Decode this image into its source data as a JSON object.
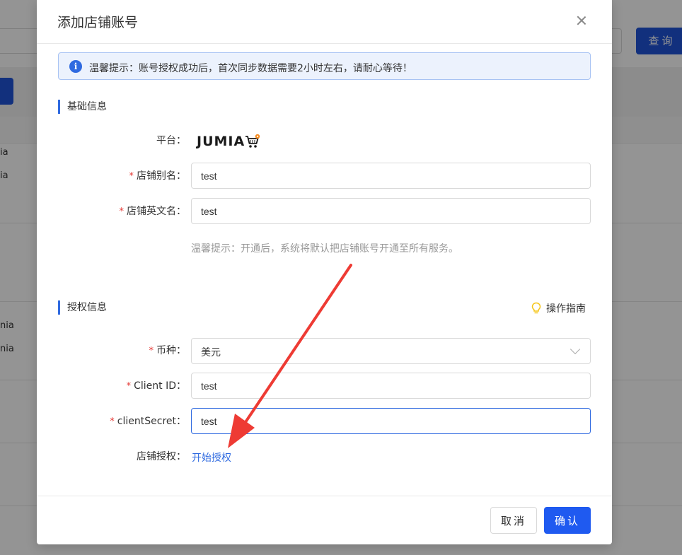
{
  "background": {
    "search_button_label": "查询",
    "rows": [
      "ia",
      "ia",
      "nia",
      "nia"
    ]
  },
  "modal": {
    "title": "添加店铺账号",
    "notice": "温馨提示：账号授权成功后，首次同步数据需要2小时左右，请耐心等待！",
    "basic_section": {
      "title": "基础信息",
      "platform_label": "平台：",
      "platform_logo_text": "JUMIA",
      "alias_label": "店铺别名：",
      "alias_value": "test",
      "en_name_label": "店铺英文名：",
      "en_name_value": "test",
      "hint": "温馨提示：开通后，系统将默认把店铺账号开通至所有服务。"
    },
    "auth_section": {
      "title": "授权信息",
      "guide_label": "操作指南",
      "currency_label": "币种：",
      "currency_value": "美元",
      "client_id_label": "Client ID：",
      "client_id_value": "test",
      "client_secret_label": "clientSecret：",
      "client_secret_value": "test",
      "store_auth_label": "店铺授权：",
      "store_auth_link": "开始授权"
    },
    "footer": {
      "cancel_label": "取消",
      "confirm_label": "确认"
    }
  },
  "colors": {
    "primary": "#1f5af0",
    "required": "#e53935",
    "annotation_arrow": "#ee3b34"
  }
}
